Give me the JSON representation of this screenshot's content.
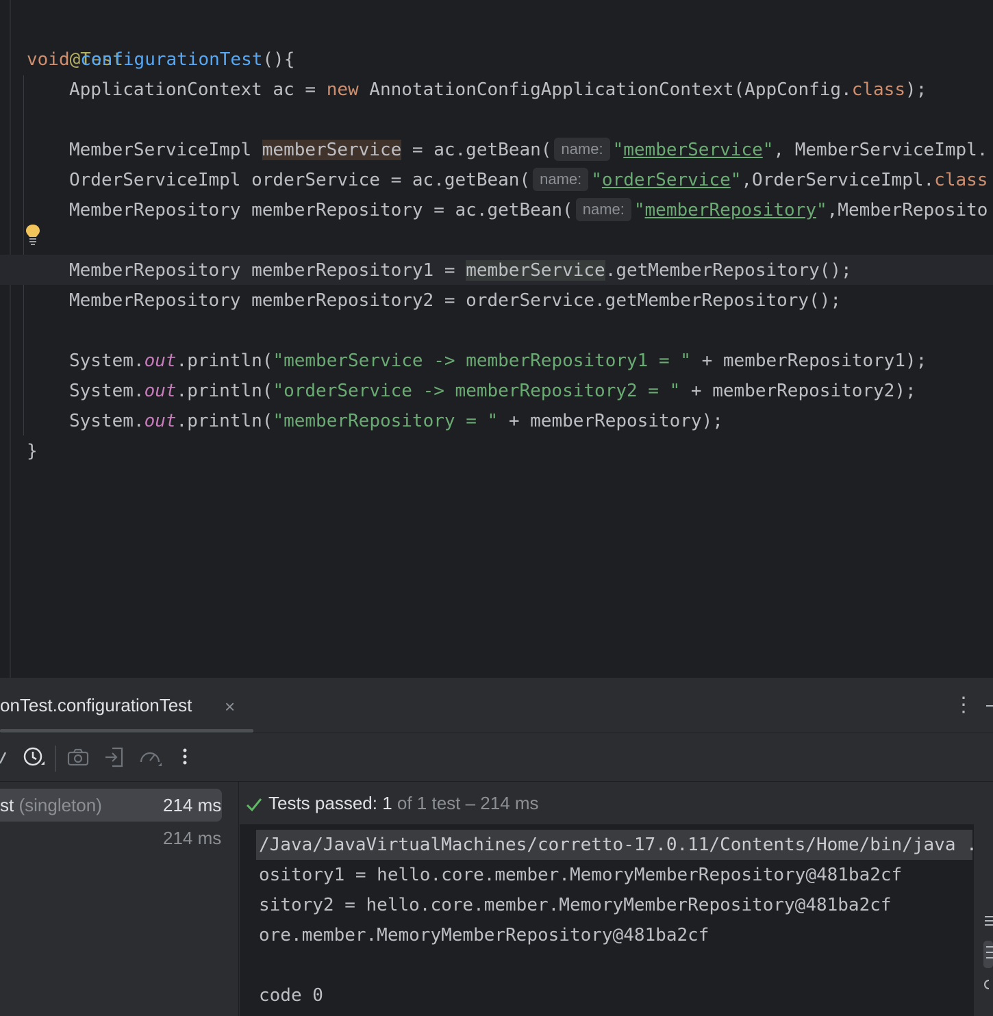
{
  "editor": {
    "lines": {
      "annotation": "@Test",
      "sig_kw": "void",
      "sig_fn": "configurationTest",
      "sig_rest": "(){",
      "l1_a": "ApplicationContext ac = ",
      "l1_new": "new",
      "l1_b": " AnnotationConfigApplicationContext(AppConfig.",
      "l1_class": "class",
      "l1_c": ");",
      "l2_a": "MemberServiceImpl ",
      "l2_var": "memberService",
      "l2_b": " = ac.getBean(",
      "l2_hint": "name:",
      "l2_q1": "\"",
      "l2_str": "memberService",
      "l2_q2": "\"",
      "l2_c": ", MemberServiceImpl.",
      "l3_a": "OrderServiceImpl orderService = ac.getBean(",
      "l3_hint": "name:",
      "l3_q1": "\"",
      "l3_str": "orderService",
      "l3_q2": "\"",
      "l3_c": ",OrderServiceImpl.",
      "l3_class": "class",
      "l4_a": "MemberRepository memberRepository = ac.getBean(",
      "l4_hint": "name:",
      "l4_q1": "\"",
      "l4_str": "memberRepository",
      "l4_q2": "\"",
      "l4_c": ",MemberReposito",
      "l5_a": "MemberRepository memberRepository1 = ",
      "l5_var": "memberService",
      "l5_b": ".getMemberRepository();",
      "l6": "MemberRepository memberRepository2 = orderService.getMemberRepository();",
      "l7_a": "System.",
      "l7_out": "out",
      "l7_b": ".println(",
      "l7_str": "\"memberService -> memberRepository1 = \"",
      "l7_c": " + memberRepository1);",
      "l8_a": "System.",
      "l8_out": "out",
      "l8_b": ".println(",
      "l8_str": "\"orderService -> memberRepository2 = \"",
      "l8_c": " + memberRepository2);",
      "l9_a": "System.",
      "l9_out": "out",
      "l9_b": ".println(",
      "l9_str": "\"memberRepository = \"",
      "l9_c": " + memberRepository);",
      "close": "}"
    }
  },
  "run_panel": {
    "tab_title": "onTest.configurationTest",
    "tab_close": "×",
    "menu": "⋮",
    "toolbar_icons": [
      "check-icon",
      "history-icon",
      "camera-icon",
      "import-icon",
      "speedometer-icon",
      "more-icon"
    ],
    "tree": [
      {
        "name": "st",
        "suffix": " (singleton)",
        "time": "214 ms"
      },
      {
        "name": "",
        "suffix": "",
        "time": "214 ms"
      }
    ],
    "status": {
      "label": "Tests passed: 1",
      "detail": " of 1 test – 214 ms"
    },
    "output": [
      "/Java/JavaVirtualMachines/corretto-17.0.11/Contents/Home/bin/java ..",
      "ository1 = hello.core.member.MemoryMemberRepository@481ba2cf",
      "sitory2 = hello.core.member.MemoryMemberRepository@481ba2cf",
      "ore.member.MemoryMemberRepository@481ba2cf",
      "",
      "code 0"
    ]
  },
  "colors": {
    "editor_bg": "#1e1f22",
    "panel_bg": "#2b2d30",
    "keyword": "#cf8e6d",
    "string": "#6aab73",
    "function": "#56a8f5",
    "annotation": "#b3ae60",
    "success": "#5fb865"
  }
}
